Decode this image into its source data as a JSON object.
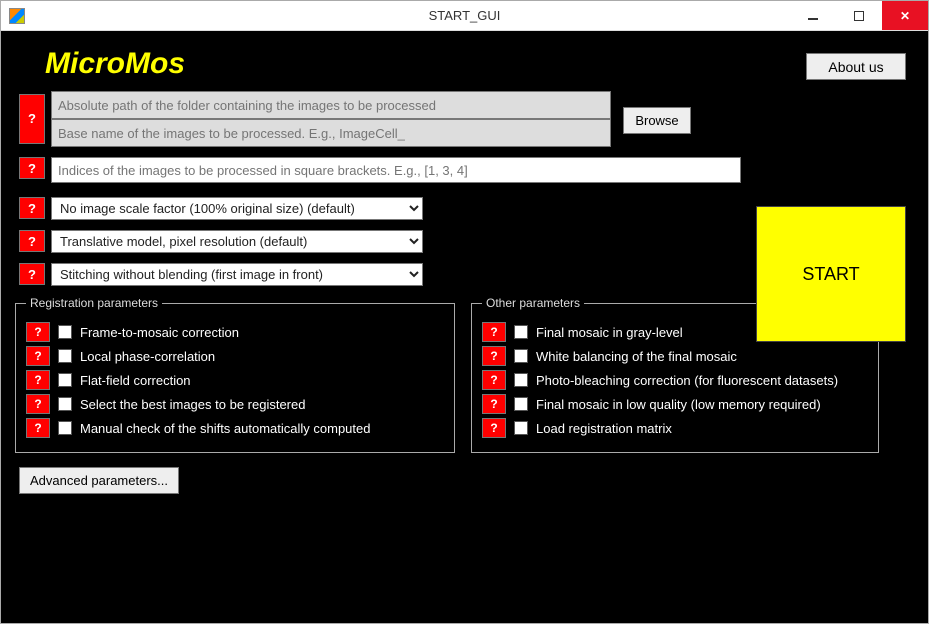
{
  "window": {
    "title": "START_GUI"
  },
  "header": {
    "app_name": "MicroMos",
    "about_label": "About us"
  },
  "inputs": {
    "folder_placeholder": "Absolute path of the folder containing the images to be processed",
    "basename_placeholder": "Base name of the images to be processed. E.g., ImageCell_",
    "indices_placeholder": "Indices of the images to be processed in square brackets. E.g., [1, 3, 4]",
    "browse_label": "Browse"
  },
  "selects": {
    "scale": "No image scale factor (100% original size) (default)",
    "model": "Translative model, pixel resolution (default)",
    "stitch": "Stitching without blending (first image in front)"
  },
  "help_label": "?",
  "start_label": "START",
  "groups": {
    "registration": {
      "legend": "Registration parameters",
      "items": [
        "Frame-to-mosaic correction",
        "Local phase-correlation",
        "Flat-field correction",
        "Select the best images to be registered",
        "Manual check of the shifts automatically computed"
      ]
    },
    "other": {
      "legend": "Other parameters",
      "items": [
        "Final mosaic in gray-level",
        "White balancing of the final mosaic",
        "Photo-bleaching correction (for fluorescent datasets)",
        "Final mosaic in low quality (low memory required)",
        "Load registration matrix"
      ]
    }
  },
  "advanced_label": "Advanced parameters..."
}
